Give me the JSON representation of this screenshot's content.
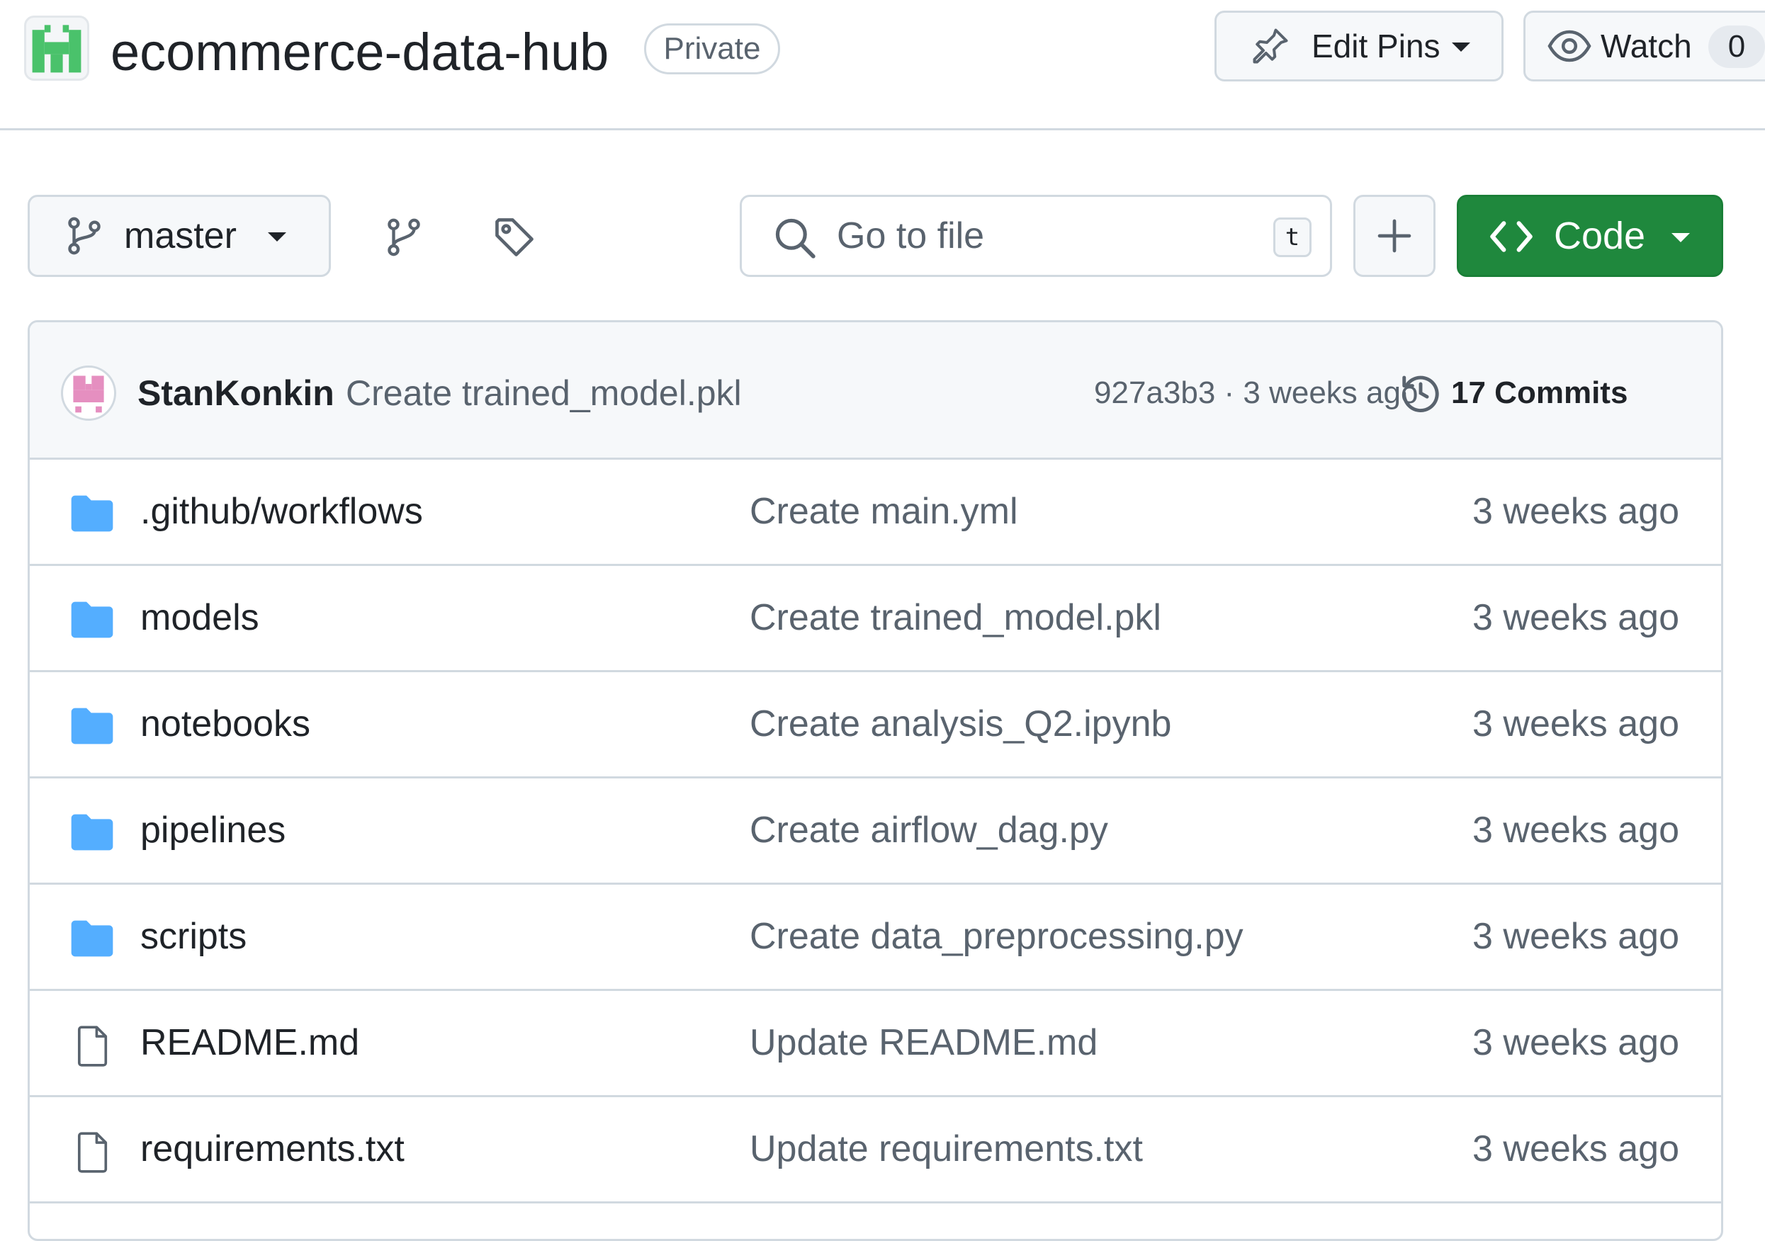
{
  "repo": {
    "name": "ecommerce-data-hub",
    "visibility": "Private"
  },
  "header_actions": {
    "edit_pins_label": "Edit Pins",
    "watch_label": "Watch",
    "watch_count": "0"
  },
  "toolbar": {
    "branch": "master",
    "search_placeholder": "Go to file",
    "search_shortcut": "t",
    "code_label": "Code"
  },
  "latest_commit": {
    "author": "StanKonkin",
    "message": "Create trained_model.pkl",
    "meta": "927a3b3 · 3 weeks ago",
    "commits_label": "17 Commits"
  },
  "files": [
    {
      "type": "dir",
      "name": ".github/workflows",
      "message": "Create main.yml",
      "age": "3 weeks ago"
    },
    {
      "type": "dir",
      "name": "models",
      "message": "Create trained_model.pkl",
      "age": "3 weeks ago"
    },
    {
      "type": "dir",
      "name": "notebooks",
      "message": "Create analysis_Q2.ipynb",
      "age": "3 weeks ago"
    },
    {
      "type": "dir",
      "name": "pipelines",
      "message": "Create airflow_dag.py",
      "age": "3 weeks ago"
    },
    {
      "type": "dir",
      "name": "scripts",
      "message": "Create data_preprocessing.py",
      "age": "3 weeks ago"
    },
    {
      "type": "file",
      "name": "README.md",
      "message": "Update README.md",
      "age": "3 weeks ago"
    },
    {
      "type": "file",
      "name": "requirements.txt",
      "message": "Update requirements.txt",
      "age": "3 weeks ago"
    }
  ],
  "colors": {
    "accent_green": "#1f883d",
    "folder_blue": "#54aeff",
    "border": "#d1d9e0",
    "muted_text": "#59636e"
  }
}
